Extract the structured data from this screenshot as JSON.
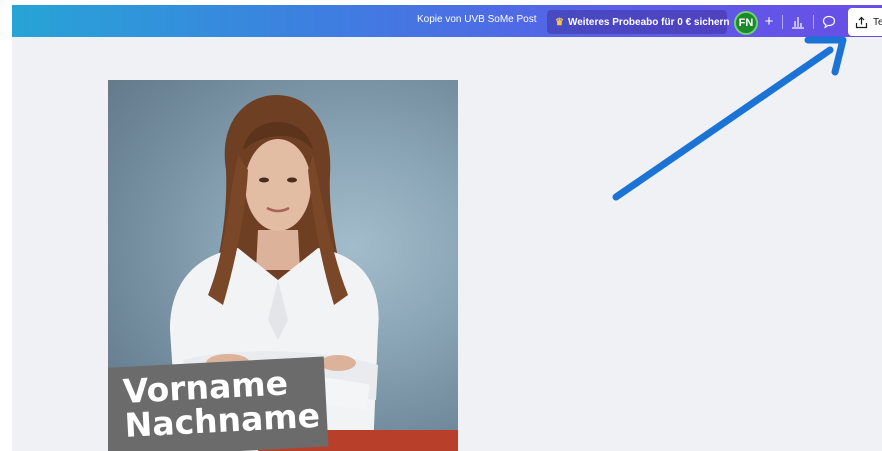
{
  "header": {
    "doc_title": "Kopie von UVB SoMe Post",
    "upgrade_label": "Weiteres Probeabo für 0 € sichern",
    "avatar_initials": "FN",
    "add_label": "+",
    "share_label": "Teile"
  },
  "canvas": {
    "first_name": "Vorname",
    "last_name": "Nachname"
  },
  "colors": {
    "gradient_start": "#27a4d6",
    "gradient_end": "#6a4de6",
    "avatar_bg": "#1c8a2c",
    "accent_red": "#b8402a",
    "arrow_blue": "#1b73d6"
  },
  "icons": [
    "crown-icon",
    "plus-icon",
    "analytics-icon",
    "comment-icon",
    "share-icon",
    "arrow-annotation"
  ]
}
